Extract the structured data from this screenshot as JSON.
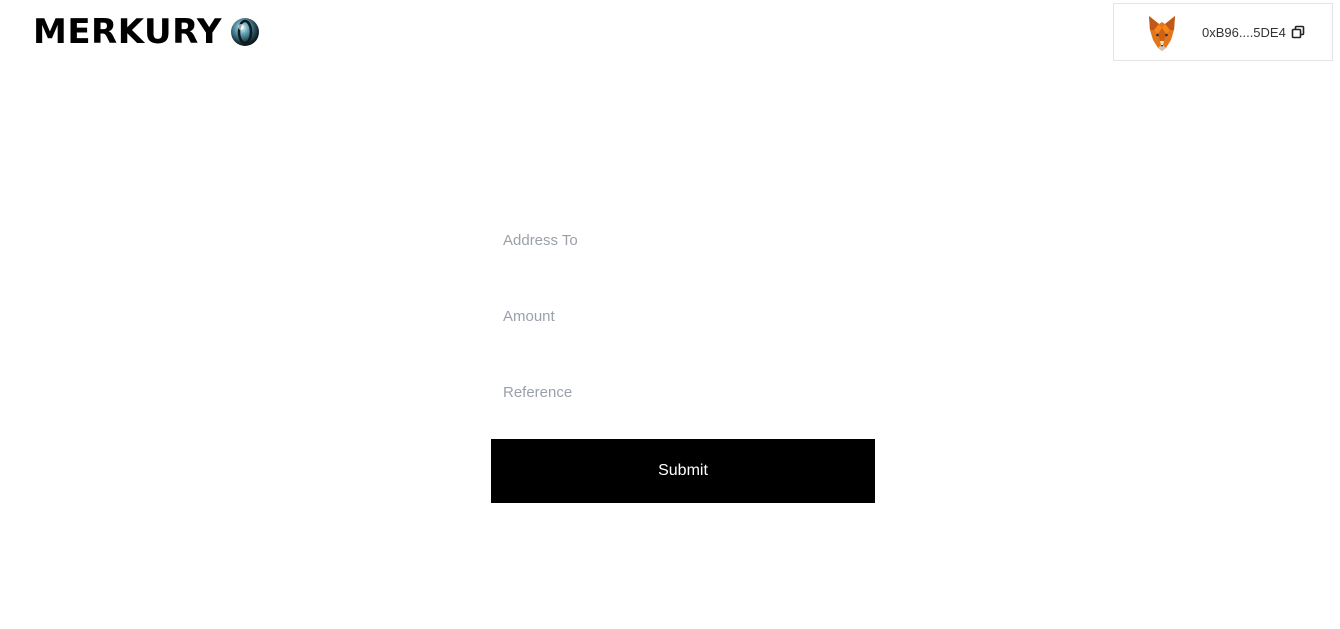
{
  "header": {
    "brand": "MERKURY",
    "brand_icon": "planet-orb-icon"
  },
  "wallet": {
    "provider_icon": "metamask-fox-icon",
    "address": "0xB96....5DE4",
    "copy_icon": "copy-icon"
  },
  "form": {
    "address_placeholder": "Address To",
    "address_value": "",
    "amount_placeholder": "Amount",
    "amount_value": "",
    "reference_placeholder": "Reference",
    "reference_value": "",
    "submit_label": "Submit"
  },
  "colors": {
    "button_bg": "#000000",
    "button_text": "#ffffff",
    "placeholder": "#9aa1ab",
    "fox_orange": "#e2761b"
  }
}
